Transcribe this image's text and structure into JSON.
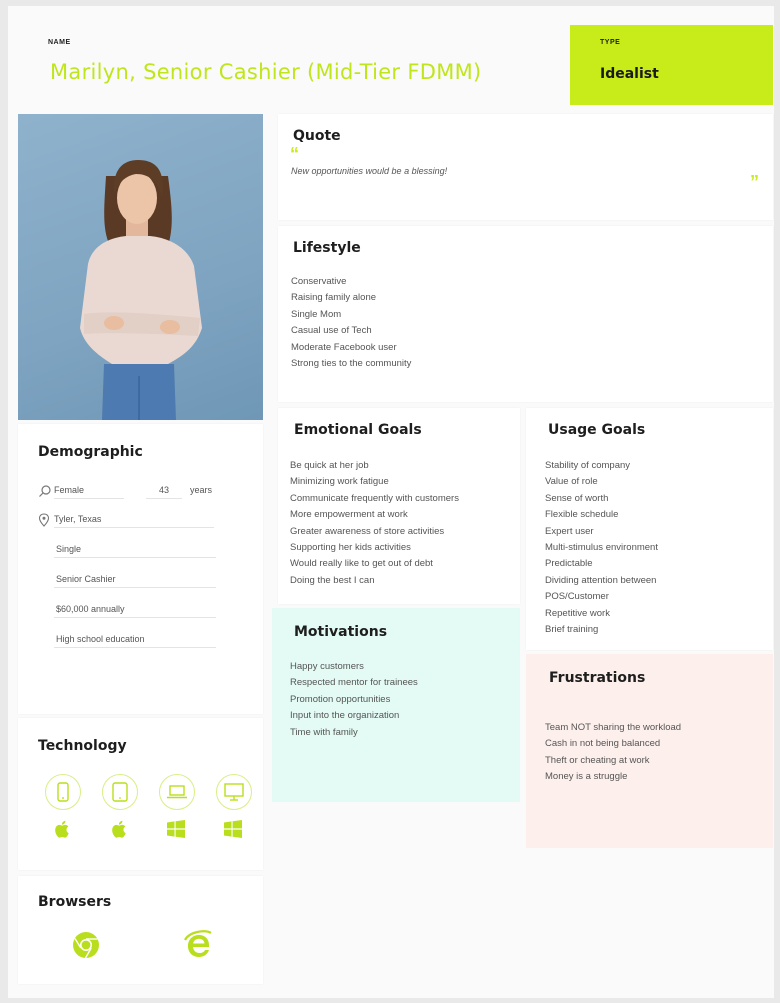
{
  "header": {
    "name_label": "NAME",
    "name": "Marilyn, Senior Cashier (Mid-Tier FDMM)",
    "type_label": "TYPE",
    "type_value": "Idealist"
  },
  "colors": {
    "accent": "#c7ec1a",
    "motivations_bg": "#e3fbf4",
    "frustrations_bg": "#fdf0ec"
  },
  "quote": {
    "title": "Quote",
    "open_mark": "“",
    "text": "New opportunities would be a blessing!",
    "close_mark": "”"
  },
  "lifestyle": {
    "title": "Lifestyle",
    "items": [
      "Conservative",
      "Raising family alone",
      "Single Mom",
      "Casual use of Tech",
      "Moderate Facebook user",
      "Strong ties to the community"
    ]
  },
  "demographic": {
    "title": "Demographic",
    "gender": "Female",
    "age": "43",
    "age_unit": "years",
    "location": "Tyler, Texas",
    "fields": [
      "Single",
      "Senior Cashier",
      "$60,000 annually",
      "High school education"
    ]
  },
  "emotional_goals": {
    "title": "Emotional Goals",
    "items": [
      "Be quick at her job",
      "Minimizing work fatigue",
      "Communicate frequently with customers",
      "More empowerment at work",
      "Greater awareness of store activities",
      "Supporting her kids activities",
      "Would really like to get out of debt",
      "Doing the best I can"
    ]
  },
  "usage_goals": {
    "title": "Usage Goals",
    "items": [
      "Stability of company",
      "Value of role",
      "Sense of worth",
      "Flexible schedule",
      "Expert user",
      "Multi-stimulus environment",
      "Predictable",
      "Dividing attention between",
      "POS/Customer",
      "Repetitive work",
      "Brief training"
    ]
  },
  "motivations": {
    "title": "Motivations",
    "items": [
      "Happy customers",
      "Respected mentor for trainees",
      "Promotion opportunities",
      "Input into the organization",
      "Time with family"
    ]
  },
  "frustrations": {
    "title": "Frustrations",
    "items": [
      "Team NOT sharing the workload",
      "Cash in not being balanced",
      "Theft or cheating at work",
      "Money is a struggle"
    ]
  },
  "technology": {
    "title": "Technology",
    "devices": [
      "phone-icon",
      "tablet-icon",
      "laptop-icon",
      "desktop-icon"
    ],
    "platforms": [
      "apple-icon",
      "apple-icon",
      "windows-icon",
      "windows-icon"
    ]
  },
  "browsers": {
    "title": "Browsers",
    "items": [
      "chrome-icon",
      "internet-explorer-icon"
    ]
  }
}
